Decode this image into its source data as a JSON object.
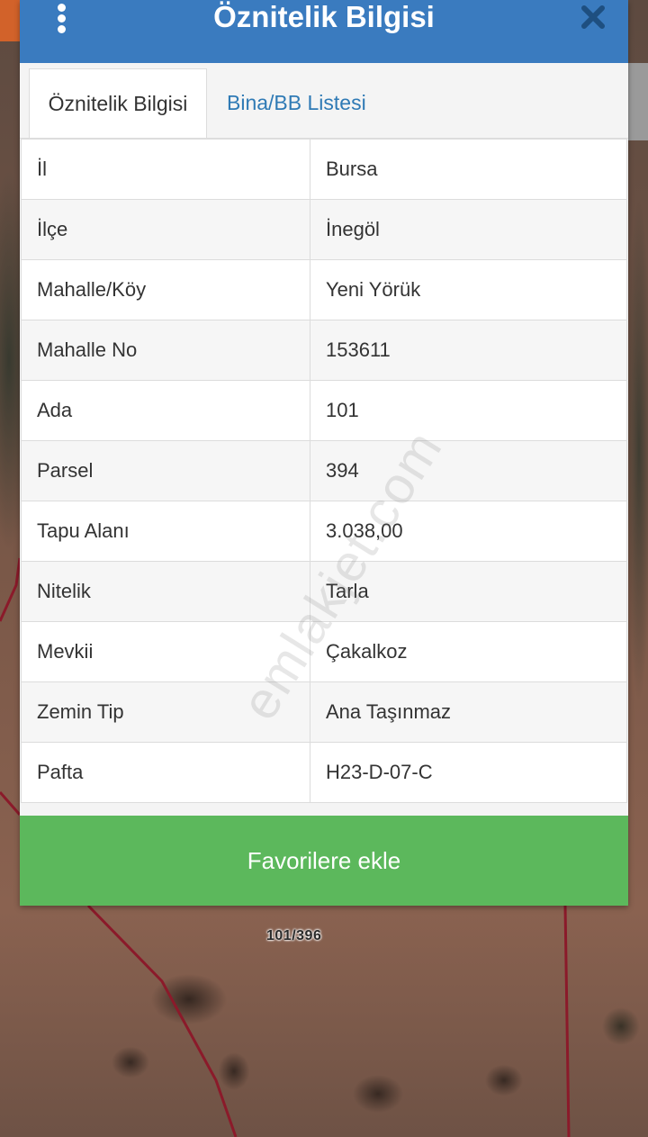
{
  "dialog": {
    "title": "Öznitelik Bilgisi",
    "tabs": [
      {
        "label": "Öznitelik Bilgisi",
        "active": true
      },
      {
        "label": "Bina/BB Listesi",
        "active": false
      }
    ],
    "rows": [
      {
        "key": "İl",
        "value": "Bursa"
      },
      {
        "key": "İlçe",
        "value": "İnegöl"
      },
      {
        "key": "Mahalle/Köy",
        "value": "Yeni Yörük"
      },
      {
        "key": "Mahalle No",
        "value": "153611"
      },
      {
        "key": "Ada",
        "value": "101"
      },
      {
        "key": "Parsel",
        "value": "394"
      },
      {
        "key": "Tapu Alanı",
        "value": "3.038,00"
      },
      {
        "key": "Nitelik",
        "value": "Tarla"
      },
      {
        "key": "Mevkii",
        "value": "Çakalkoz"
      },
      {
        "key": "Zemin Tip",
        "value": "Ana Taşınmaz"
      },
      {
        "key": "Pafta",
        "value": "H23-D-07-C"
      }
    ],
    "favorite_button": "Favorilere ekle"
  },
  "map": {
    "parcel_label": "101/396",
    "boundary_color": "#8b1a2a"
  },
  "watermark": "emlakjet.com",
  "colors": {
    "header": "#3a7bbf",
    "tab_link": "#2f7ab5",
    "favorite_button": "#5cb85c"
  },
  "icons": {
    "menu": "kebab-menu-icon",
    "close": "close-x-icon"
  }
}
